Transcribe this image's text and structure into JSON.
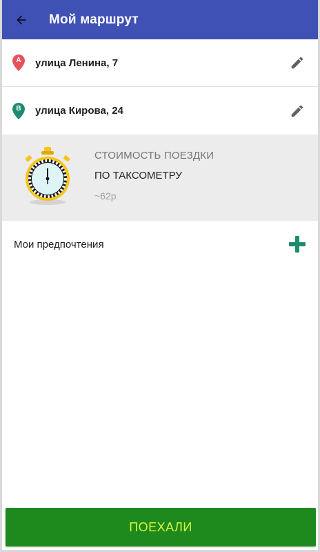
{
  "header": {
    "title": "Мой маршрут",
    "back_icon": "arrow-back-icon",
    "color": "#3f51b5"
  },
  "route": {
    "points": [
      {
        "letter": "A",
        "address": "улица Ленина, 7",
        "marker_color": "#e5535c",
        "edit_icon": "pencil-icon"
      },
      {
        "letter": "B",
        "address": "улица Кирова, 24",
        "marker_color": "#1e8a6e",
        "edit_icon": "pencil-icon"
      }
    ]
  },
  "fare": {
    "label": "СТОИМОСТЬ ПОЕЗДКИ",
    "type": "ПО ТАКСОМЕТРУ",
    "price": "~62р",
    "icon": "stopwatch-icon"
  },
  "preferences": {
    "label": "Мои предпочтения",
    "add_icon": "plus-icon",
    "add_color": "#1e8a6e"
  },
  "action": {
    "label": "ПОЕХАЛИ",
    "color": "#1e8a1e",
    "text_color": "#d7f53c"
  }
}
